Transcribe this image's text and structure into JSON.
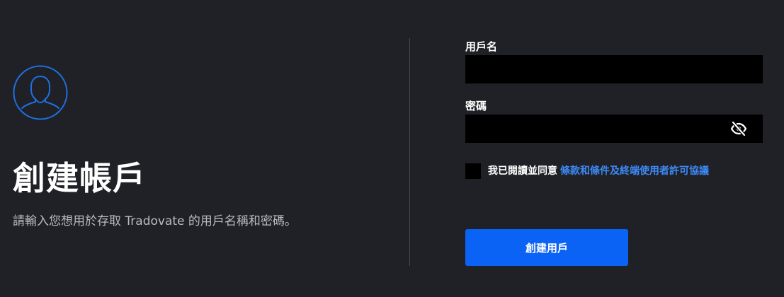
{
  "left": {
    "avatar_icon": "user-avatar-icon",
    "title": "創建帳戶",
    "subtitle": "請輸入您想用於存取 Tradovate 的用戶名稱和密碼。"
  },
  "form": {
    "username_label": "用戶名",
    "username_value": "",
    "password_label": "密碼",
    "password_value": "",
    "password_toggle_icon": "eye-slash-icon",
    "agree_text": "我已閱讀並同意",
    "terms_link": "條款和條件及終端使用者許可協議",
    "checkbox_checked": false,
    "submit_label": "創建用戶"
  },
  "colors": {
    "background": "#202126",
    "accent": "#0b63f6",
    "link": "#3d8af7",
    "input_bg": "#000000",
    "subtitle": "#b9bcc4"
  }
}
